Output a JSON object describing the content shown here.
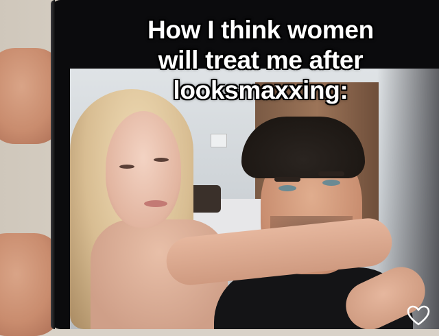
{
  "caption": {
    "lines": [
      "How I think women",
      "will treat me after",
      "looksmaxxing:"
    ]
  },
  "controls": {
    "like_icon": "heart-outline-icon"
  },
  "colors": {
    "caption_text": "#ffffff",
    "phone_bezel": "#0b0b0d"
  }
}
